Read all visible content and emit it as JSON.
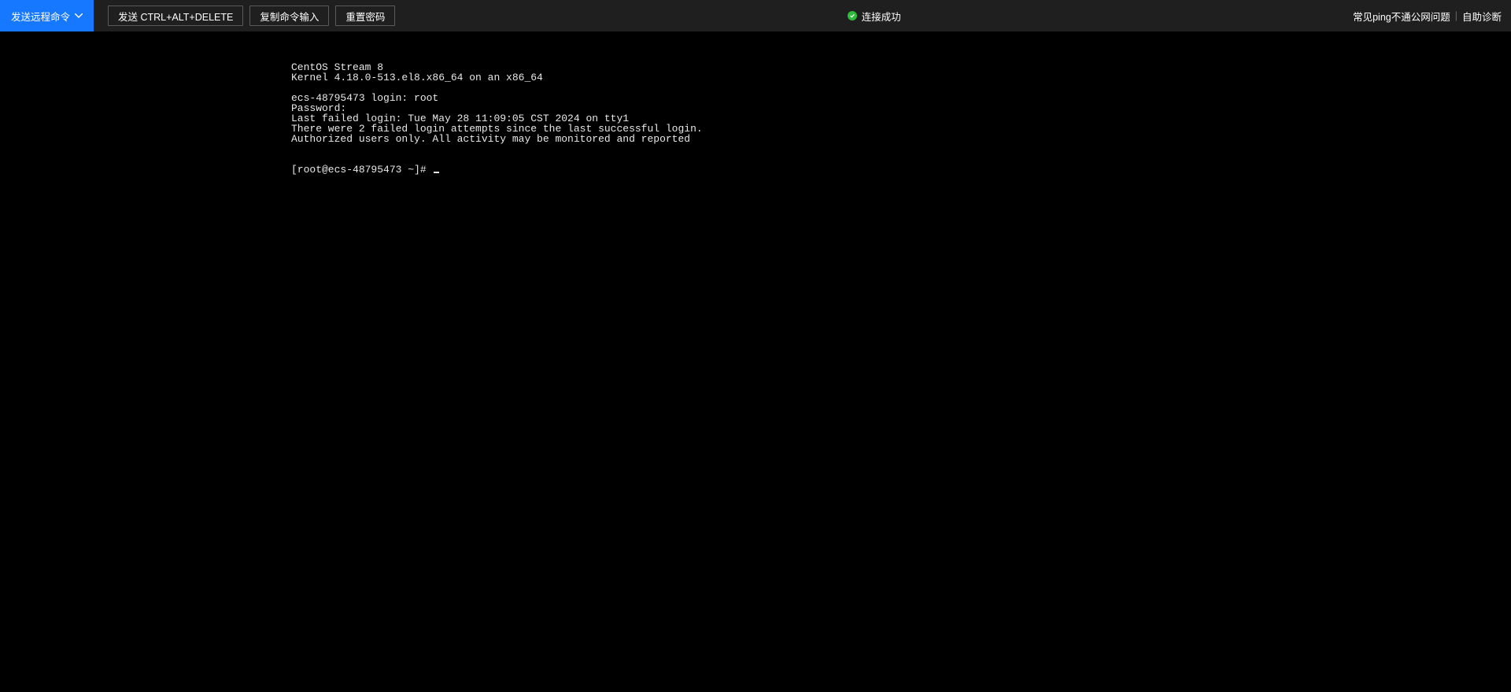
{
  "toolbar": {
    "send_remote_cmd": "发送远程命令",
    "send_ctrl_alt_del": "发送 CTRL+ALT+DELETE",
    "copy_cmd_input": "复制命令输入",
    "reset_password": "重置密码"
  },
  "status": {
    "text": "连接成功"
  },
  "links": {
    "ping_issue": "常见ping不通公网问题",
    "separator": "|",
    "self_diagnosis": "自助诊断"
  },
  "terminal": {
    "lines": [
      "CentOS Stream 8",
      "Kernel 4.18.0-513.el8.x86_64 on an x86_64",
      "",
      "ecs-48795473 login: root",
      "Password:",
      "Last failed login: Tue May 28 11:09:05 CST 2024 on tty1",
      "There were 2 failed login attempts since the last successful login.",
      "Authorized users only. All activity may be monitored and reported"
    ],
    "prompt": "[root@ecs-48795473 ~]# "
  }
}
